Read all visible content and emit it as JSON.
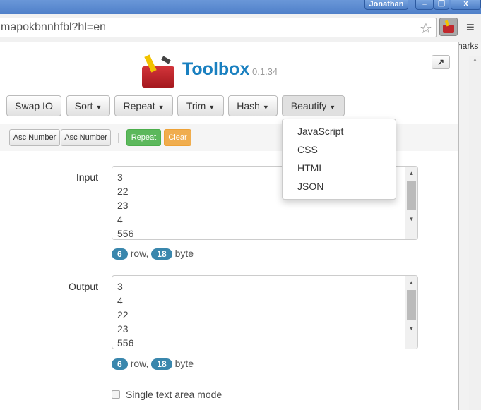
{
  "window": {
    "user": "Jonathan",
    "minimize": "–",
    "restore": "❐",
    "close": "X"
  },
  "browser": {
    "url": "mapokbnnhfbl?hl=en",
    "bookmarks_fragment": "harks",
    "star_icon": "☆",
    "menu_icon": "≡"
  },
  "app": {
    "title": "Toolbox",
    "version": "0.1.34",
    "popout_icon": "↗"
  },
  "toolbar": [
    {
      "label": "Swap IO",
      "dropdown": false
    },
    {
      "label": "Sort",
      "dropdown": true
    },
    {
      "label": "Repeat",
      "dropdown": true
    },
    {
      "label": "Trim",
      "dropdown": true
    },
    {
      "label": "Hash",
      "dropdown": true
    },
    {
      "label": "Beautify",
      "dropdown": true
    }
  ],
  "subbar": {
    "btn1": "Asc Number",
    "btn2": "Asc Number",
    "repeat": "Repeat",
    "clear": "Clear",
    "repeat_color": "#5cb85c",
    "clear_color": "#f0ad4e"
  },
  "beautify_menu": [
    "JavaScript",
    "CSS",
    "HTML",
    "JSON"
  ],
  "input": {
    "label": "Input",
    "lines": [
      "3",
      "22",
      "23",
      "4",
      "556"
    ],
    "rows": "6",
    "bytes": "18"
  },
  "output": {
    "label": "Output",
    "lines": [
      "3",
      "4",
      "22",
      "23",
      "556"
    ],
    "rows": "6",
    "bytes": "18"
  },
  "stats": {
    "row_text": "row,",
    "byte_text": "byte"
  },
  "single_mode": {
    "label": "Single text area mode",
    "checked": false
  }
}
